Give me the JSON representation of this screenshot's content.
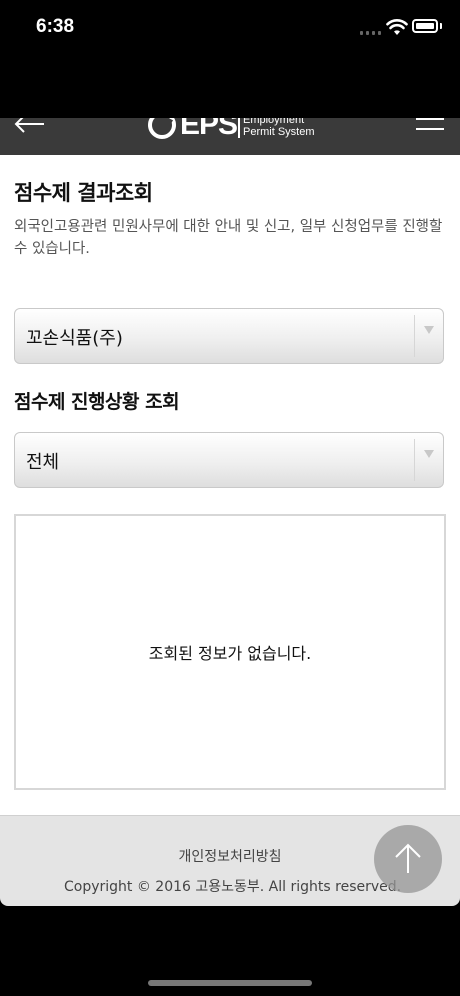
{
  "status_bar": {
    "time": "6:38"
  },
  "header": {
    "logo_text": "EPS",
    "logo_sub_line1": "Employment",
    "logo_sub_line2": "Permit System"
  },
  "page": {
    "title": "점수제 결과조회",
    "description": "외국인고용관련 민원사무에 대한 안내 및 신고, 일부 신청업무를 진행할 수 있습니다."
  },
  "company_select": {
    "value": "꼬손식품(주)"
  },
  "status_section": {
    "title": "점수제 진행상황 조회"
  },
  "status_select": {
    "value": "전체"
  },
  "results": {
    "empty_message": "조회된 정보가 없습니다."
  },
  "footer": {
    "privacy_link": "개인정보처리방침",
    "copyright": "Copyright © 2016 고용노동부. All rights reserved."
  },
  "colors": {
    "header_bg": "#3a3a3a",
    "footer_bg": "#e4e4e4",
    "page_bg": "#ffffff"
  }
}
